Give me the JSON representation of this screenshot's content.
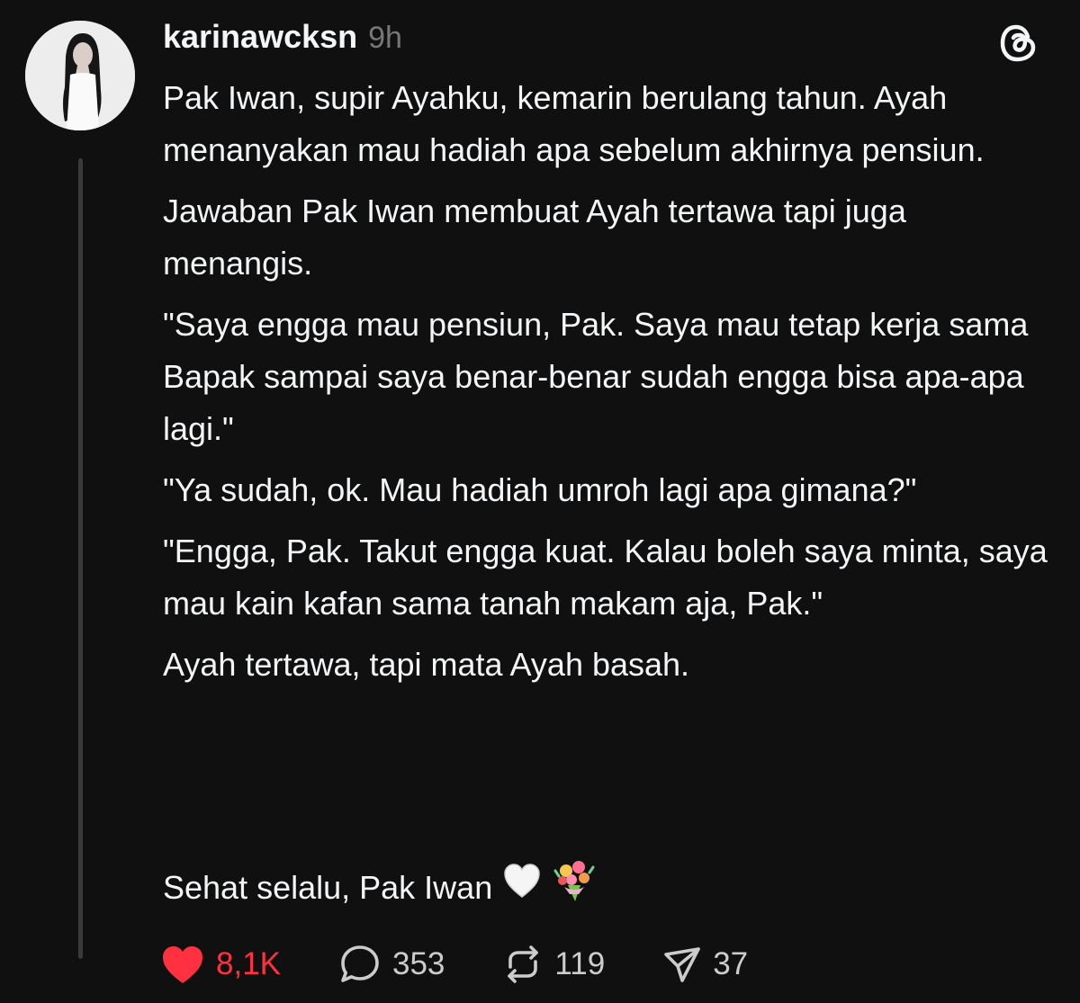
{
  "post": {
    "username": "karinawcksn",
    "time": "9h",
    "paragraphs": [
      "Pak Iwan, supir Ayahku, kemarin berulang tahun. Ayah menanyakan mau hadiah apa sebelum akhirnya pensiun.",
      "Jawaban Pak Iwan membuat Ayah tertawa tapi juga menangis.",
      "\"Saya engga mau pensiun, Pak. Saya mau tetap kerja sama Bapak sampai saya benar-benar sudah engga bisa apa-apa lagi.\"",
      "\"Ya sudah, ok. Mau hadiah umroh lagi apa gimana?\"",
      "\"Engga, Pak. Takut engga kuat. Kalau boleh saya minta, saya mau kain kafan sama tanah makam aja, Pak.\"",
      "Ayah tertawa, tapi mata Ayah basah."
    ],
    "signoff": "Sehat selalu, Pak Iwan",
    "signoff_emojis": [
      "white-heart",
      "bouquet"
    ]
  },
  "actions": {
    "likes": "8,1K",
    "replies": "353",
    "reposts": "119",
    "shares": "37"
  },
  "icons": {
    "like": "heart-filled-icon",
    "reply": "speech-bubble-icon",
    "repost": "repost-arrows-icon",
    "share": "paper-plane-icon",
    "app": "threads-logo-icon"
  },
  "colors": {
    "background": "#101010",
    "text": "#f3f5f7",
    "muted": "#777777",
    "liked": "#ff3040",
    "thread_line": "#3a3a3a"
  }
}
